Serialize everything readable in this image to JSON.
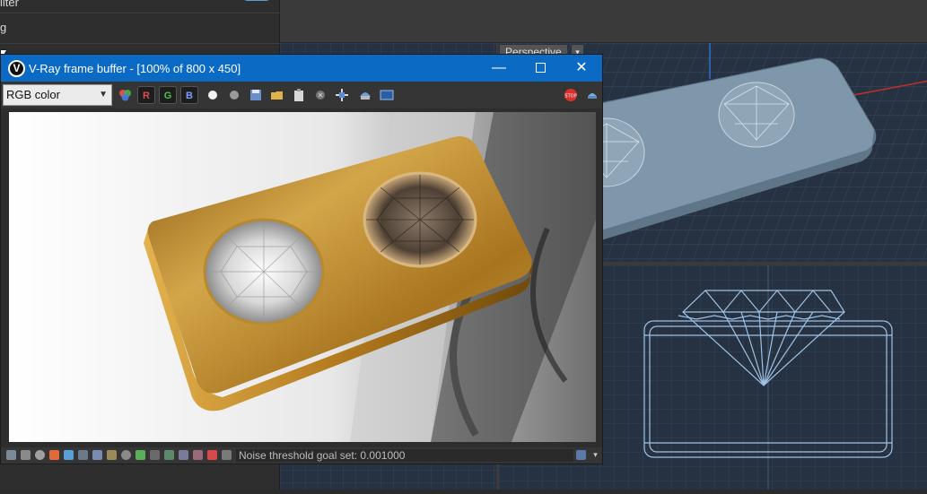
{
  "left_panel": {
    "row1_label": "ilter",
    "row2_label": "g",
    "toggle_on": true
  },
  "viewport": {
    "label": "Perspective",
    "dropdown": "▾"
  },
  "vfb": {
    "title": "V-Ray frame buffer - [100% of 800 x 450]",
    "logo_letter": "V",
    "minimize": "—",
    "close": "✕",
    "channel_select": "RGB color",
    "channel_r": "R",
    "channel_g": "G",
    "channel_b": "B",
    "status": "Noise threshold goal set: 0.001000"
  },
  "colors": {
    "title_bar": "#0b6ac4",
    "viewport_bg": "#263242",
    "gold": "#c79a3a",
    "stop": "#d9302c"
  }
}
